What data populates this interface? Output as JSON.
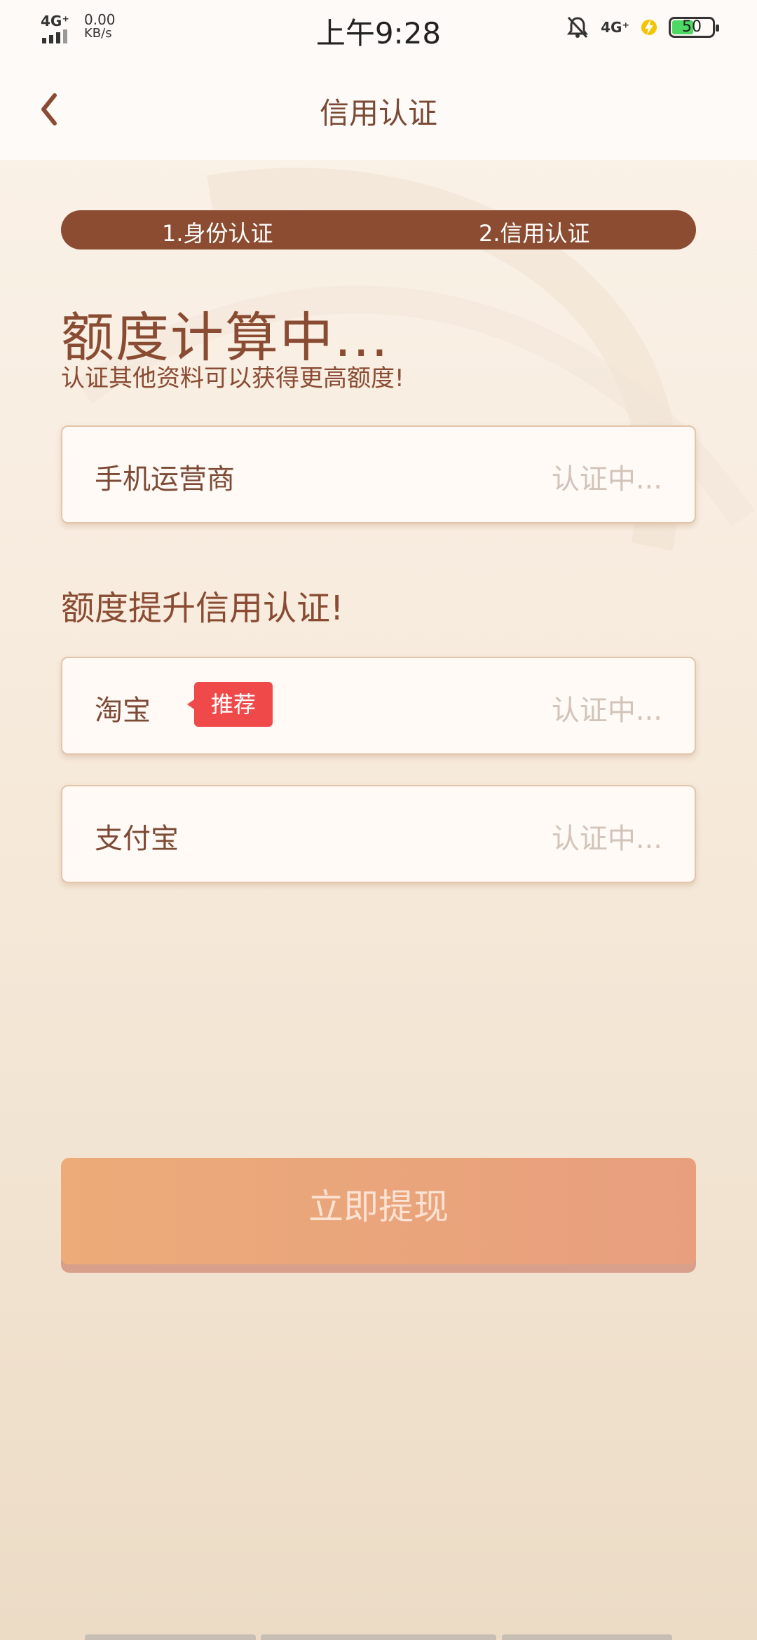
{
  "status_bar": {
    "network": "4G⁺",
    "speed_value": "0.00",
    "speed_unit": "KB/s",
    "time": "上午9:28",
    "network_right": "4G⁺",
    "battery_level": "50"
  },
  "nav": {
    "title": "信用认证"
  },
  "steps": {
    "step1": "1.身份认证",
    "step2": "2.信用认证"
  },
  "heading": {
    "title": "额度计算中...",
    "subtitle": "认证其他资料可以获得更高额度!"
  },
  "primary_cards": [
    {
      "label": "手机运营商",
      "status": "认证中..."
    }
  ],
  "section2_title": "额度提升信用认证!",
  "boost_cards": [
    {
      "label": "淘宝",
      "badge": "推荐",
      "status": "认证中..."
    },
    {
      "label": "支付宝",
      "status": "认证中..."
    }
  ],
  "cta": {
    "label": "立即提现"
  },
  "colors": {
    "brand_brown": "#8b4c31",
    "badge_red": "#f0494a",
    "cta_orange": "#eba776"
  }
}
